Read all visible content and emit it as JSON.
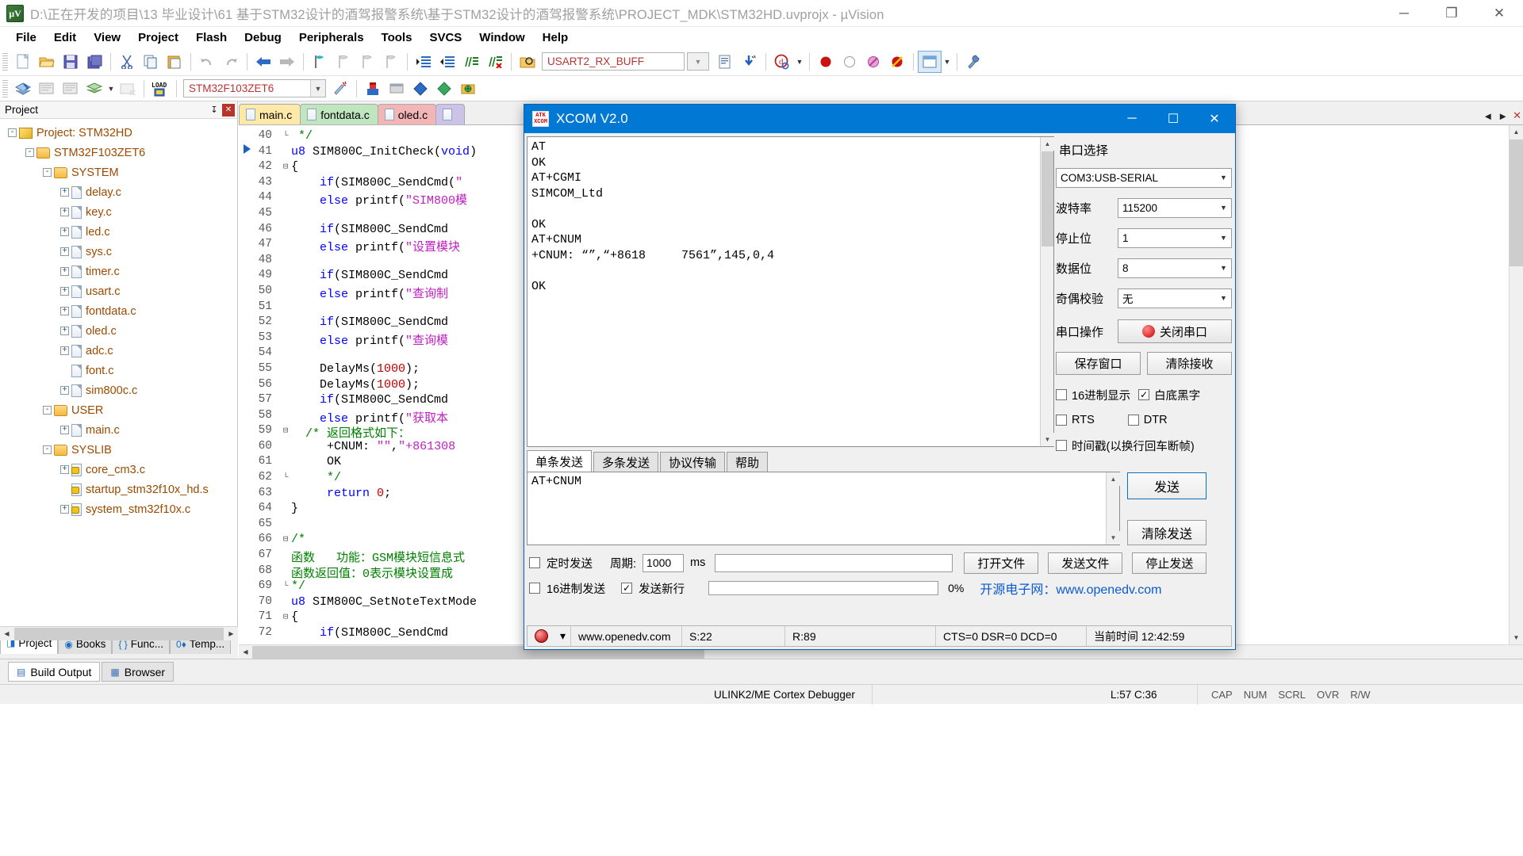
{
  "window": {
    "title": "D:\\正在开发的项目\\13 毕业设计\\61 基于STM32设计的酒驾报警系统\\基于STM32设计的酒驾报警系统\\PROJECT_MDK\\STM32HD.uvprojx - µVision",
    "app_icon_text": "µV",
    "minimize": "─",
    "maximize": "❐",
    "close": "✕"
  },
  "menubar": {
    "items": [
      "File",
      "Edit",
      "View",
      "Project",
      "Flash",
      "Debug",
      "Peripherals",
      "Tools",
      "SVCS",
      "Window",
      "Help"
    ]
  },
  "toolbar1": {
    "combo_value": "USART2_RX_BUFF"
  },
  "toolbar2": {
    "combo_value": "STM32F103ZET6",
    "load_label": "LOAD"
  },
  "project_panel": {
    "header": "Project",
    "pin": "↧",
    "close": "✕",
    "tree": [
      {
        "indent": 0,
        "expander": "-",
        "icon": "proj",
        "label": "Project: STM32HD"
      },
      {
        "indent": 1,
        "expander": "-",
        "icon": "folder",
        "label": "STM32F103ZET6"
      },
      {
        "indent": 2,
        "expander": "-",
        "icon": "folder",
        "label": "SYSTEM"
      },
      {
        "indent": 3,
        "expander": "+",
        "icon": "file",
        "label": "delay.c"
      },
      {
        "indent": 3,
        "expander": "+",
        "icon": "file",
        "label": "key.c"
      },
      {
        "indent": 3,
        "expander": "+",
        "icon": "file",
        "label": "led.c"
      },
      {
        "indent": 3,
        "expander": "+",
        "icon": "file",
        "label": "sys.c"
      },
      {
        "indent": 3,
        "expander": "+",
        "icon": "file",
        "label": "timer.c"
      },
      {
        "indent": 3,
        "expander": "+",
        "icon": "file",
        "label": "usart.c"
      },
      {
        "indent": 3,
        "expander": "+",
        "icon": "file",
        "label": "fontdata.c"
      },
      {
        "indent": 3,
        "expander": "+",
        "icon": "file",
        "label": "oled.c"
      },
      {
        "indent": 3,
        "expander": "+",
        "icon": "file",
        "label": "adc.c"
      },
      {
        "indent": 3,
        "expander": "",
        "icon": "file",
        "label": "font.c"
      },
      {
        "indent": 3,
        "expander": "+",
        "icon": "file",
        "label": "sim800c.c"
      },
      {
        "indent": 2,
        "expander": "-",
        "icon": "folder",
        "label": "USER"
      },
      {
        "indent": 3,
        "expander": "+",
        "icon": "file",
        "label": "main.c"
      },
      {
        "indent": 2,
        "expander": "-",
        "icon": "folder",
        "label": "SYSLIB"
      },
      {
        "indent": 3,
        "expander": "+",
        "icon": "keyfile",
        "label": "core_cm3.c"
      },
      {
        "indent": 3,
        "expander": "",
        "icon": "keyfile",
        "label": "startup_stm32f10x_hd.s"
      },
      {
        "indent": 3,
        "expander": "+",
        "icon": "keyfile",
        "label": "system_stm32f10x.c"
      }
    ],
    "tabs": [
      {
        "label": "Project",
        "icon": "project-icon",
        "active": true
      },
      {
        "label": "Books",
        "icon": "books-icon",
        "active": false
      },
      {
        "label": "Func...",
        "icon": "functions-icon",
        "active": false
      },
      {
        "label": "Temp...",
        "icon": "templates-icon",
        "active": false
      }
    ]
  },
  "editor": {
    "tabs": [
      {
        "label": "main.c",
        "style": "t-main"
      },
      {
        "label": "fontdata.c",
        "style": "t-font"
      },
      {
        "label": "oled.c",
        "style": "t-oled"
      },
      {
        "label": "",
        "style": "t-extra"
      }
    ],
    "tab_nav": {
      "prev": "◄",
      "next": "►",
      "close": "✕"
    },
    "lines": [
      {
        "n": 40,
        "fold": "└",
        "code": " */"
      },
      {
        "n": 41,
        "fold": "",
        "code": "u8 SIM800C_InitCheck(void)",
        "kw": [
          "void"
        ]
      },
      {
        "n": 42,
        "fold": "⊟",
        "code": "{"
      },
      {
        "n": 43,
        "fold": "",
        "code": "    if(SIM800C_SendCmd(\""
      },
      {
        "n": 44,
        "fold": "",
        "code": "    else printf(\"SIM800模"
      },
      {
        "n": 45,
        "fold": "",
        "code": ""
      },
      {
        "n": 46,
        "fold": "",
        "code": "    if(SIM800C_SendCmd"
      },
      {
        "n": 47,
        "fold": "",
        "code": "    else printf(\"设置模块"
      },
      {
        "n": 48,
        "fold": "",
        "code": ""
      },
      {
        "n": 49,
        "fold": "",
        "code": "    if(SIM800C_SendCmd"
      },
      {
        "n": 50,
        "fold": "",
        "code": "    else printf(\"查询制"
      },
      {
        "n": 51,
        "fold": "",
        "code": ""
      },
      {
        "n": 52,
        "fold": "",
        "code": "    if(SIM800C_SendCmd"
      },
      {
        "n": 53,
        "fold": "",
        "code": "    else printf(\"查询模"
      },
      {
        "n": 54,
        "fold": "",
        "code": ""
      },
      {
        "n": 55,
        "fold": "",
        "code": "    DelayMs(1000);"
      },
      {
        "n": 56,
        "fold": "",
        "code": "    DelayMs(1000);"
      },
      {
        "n": 57,
        "fold": "",
        "code": "    if(SIM800C_SendCmd"
      },
      {
        "n": 58,
        "fold": "",
        "code": "    else printf(\"获取本"
      },
      {
        "n": 59,
        "fold": "⊟",
        "code": "  /* 返回格式如下："
      },
      {
        "n": 60,
        "fold": "",
        "code": "     +CNUM: \"\",\"+861308"
      },
      {
        "n": 61,
        "fold": "",
        "code": "     OK"
      },
      {
        "n": 62,
        "fold": "└",
        "code": "     */"
      },
      {
        "n": 63,
        "fold": "",
        "code": "     return 0;"
      },
      {
        "n": 64,
        "fold": "",
        "code": "}"
      },
      {
        "n": 65,
        "fold": "",
        "code": ""
      },
      {
        "n": 66,
        "fold": "⊟",
        "code": "/*"
      },
      {
        "n": 67,
        "fold": "",
        "code": "函数   功能：GSM模块短信息式"
      },
      {
        "n": 68,
        "fold": "",
        "code": "函数返回值：0表示模块设置成"
      },
      {
        "n": 69,
        "fold": "└",
        "code": "*/"
      },
      {
        "n": 70,
        "fold": "",
        "code": "u8 SIM800C_SetNoteTextMode"
      },
      {
        "n": 71,
        "fold": "⊟",
        "code": "{"
      },
      {
        "n": 72,
        "fold": "",
        "code": "    if(SIM800C_SendCmd"
      }
    ]
  },
  "bottom_tabs": [
    {
      "label": "Build Output",
      "icon": "build-output-icon",
      "active": true
    },
    {
      "label": "Browser",
      "icon": "browser-icon",
      "active": false
    }
  ],
  "statusbar": {
    "debugger": "ULINK2/ME Cortex Debugger",
    "position": "L:57 C:36",
    "flags": [
      "CAP",
      "NUM",
      "SCRL",
      "OVR",
      "R/W"
    ]
  },
  "xcom": {
    "title": "XCOM V2.0",
    "logo_top": "ATK",
    "logo_bottom": "XCOM",
    "minimize": "─",
    "maximize": "☐",
    "close": "✕",
    "terminal_text": "AT\nOK\nAT+CGMI\nSIMCOM_Ltd\n\nOK\nAT+CNUM\n+CNUM: “”,“+8618     7561”,145,0,4\n\nOK",
    "right_panel": {
      "title": "串口选择",
      "rows": [
        {
          "label": "",
          "value": "COM3:USB-SERIAL",
          "name": "port-select"
        },
        {
          "label": "波特率",
          "value": "115200",
          "name": "baud-select"
        },
        {
          "label": "停止位",
          "value": "1",
          "name": "stopbits-select"
        },
        {
          "label": "数据位",
          "value": "8",
          "name": "databits-select"
        },
        {
          "label": "奇偶校验",
          "value": "无",
          "name": "parity-select"
        }
      ],
      "operation_label": "串口操作",
      "operation_button": "关闭串口",
      "save_window": "保存窗口",
      "clear_receive": "清除接收",
      "checks": [
        {
          "label": "16进制显示",
          "checked": false,
          "name": "hex-display-checkbox"
        },
        {
          "label": "白底黑字",
          "checked": true,
          "name": "white-bg-checkbox"
        },
        {
          "label": "RTS",
          "checked": false,
          "name": "rts-checkbox"
        },
        {
          "label": "DTR",
          "checked": false,
          "name": "dtr-checkbox"
        },
        {
          "label": "时间戳(以换行回车断帧)",
          "checked": false,
          "name": "timestamp-checkbox"
        }
      ]
    },
    "send_tabs": [
      {
        "label": "单条发送",
        "active": true
      },
      {
        "label": "多条发送",
        "active": false
      },
      {
        "label": "协议传输",
        "active": false
      },
      {
        "label": "帮助",
        "active": false
      }
    ],
    "send_text": "AT+CNUM",
    "send_button": "发送",
    "clear_send_button": "清除发送",
    "timer_send": {
      "label": "定时发送",
      "checked": false,
      "period_label": "周期:",
      "period_value": "1000",
      "unit": "ms"
    },
    "hex_send": {
      "label": "16进制发送",
      "checked": false
    },
    "newline_send": {
      "label": "发送新行",
      "checked": true
    },
    "open_file_button": "打开文件",
    "send_file_button": "发送文件",
    "stop_send_button": "停止发送",
    "progress_text": "0%",
    "promo_text": "开源电子网：www.openedv.com",
    "status": {
      "site": "www.openedv.com",
      "sent": "S:22",
      "received": "R:89",
      "signals": "CTS=0 DSR=0 DCD=0",
      "time_label": "当前时间 12:42:59",
      "dropdown": "▾"
    }
  }
}
